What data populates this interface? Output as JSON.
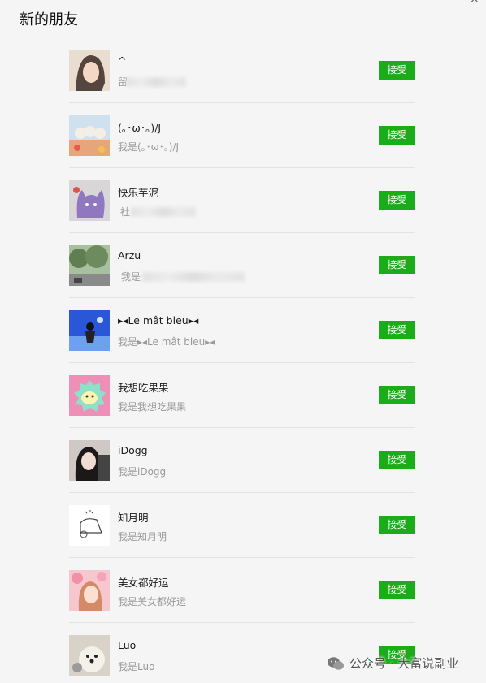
{
  "window": {
    "title": "新的朋友"
  },
  "accept_label": "接受",
  "requests": [
    {
      "name": "^",
      "message": "留"
    },
    {
      "name": "(｡･ω･｡)/J",
      "message": "我是(｡･ω･｡)/J"
    },
    {
      "name": "快乐芋泥",
      "message": "社"
    },
    {
      "name": "Arzu",
      "message": "我是"
    },
    {
      "name": "▸◂Le mât bleu▸◂",
      "message": "我是▸◂Le mât bleu▸◂"
    },
    {
      "name": "我想吃果果",
      "message": "我是我想吃果果"
    },
    {
      "name": "iDogg",
      "message": "我是iDogg"
    },
    {
      "name": "知月明",
      "message": "我是知月明"
    },
    {
      "name": "美女都好运",
      "message": "我是美女都好运"
    },
    {
      "name": "Luo",
      "message": "我是Luo"
    }
  ],
  "watermark": {
    "text": "公众号 · 大富说副业"
  }
}
